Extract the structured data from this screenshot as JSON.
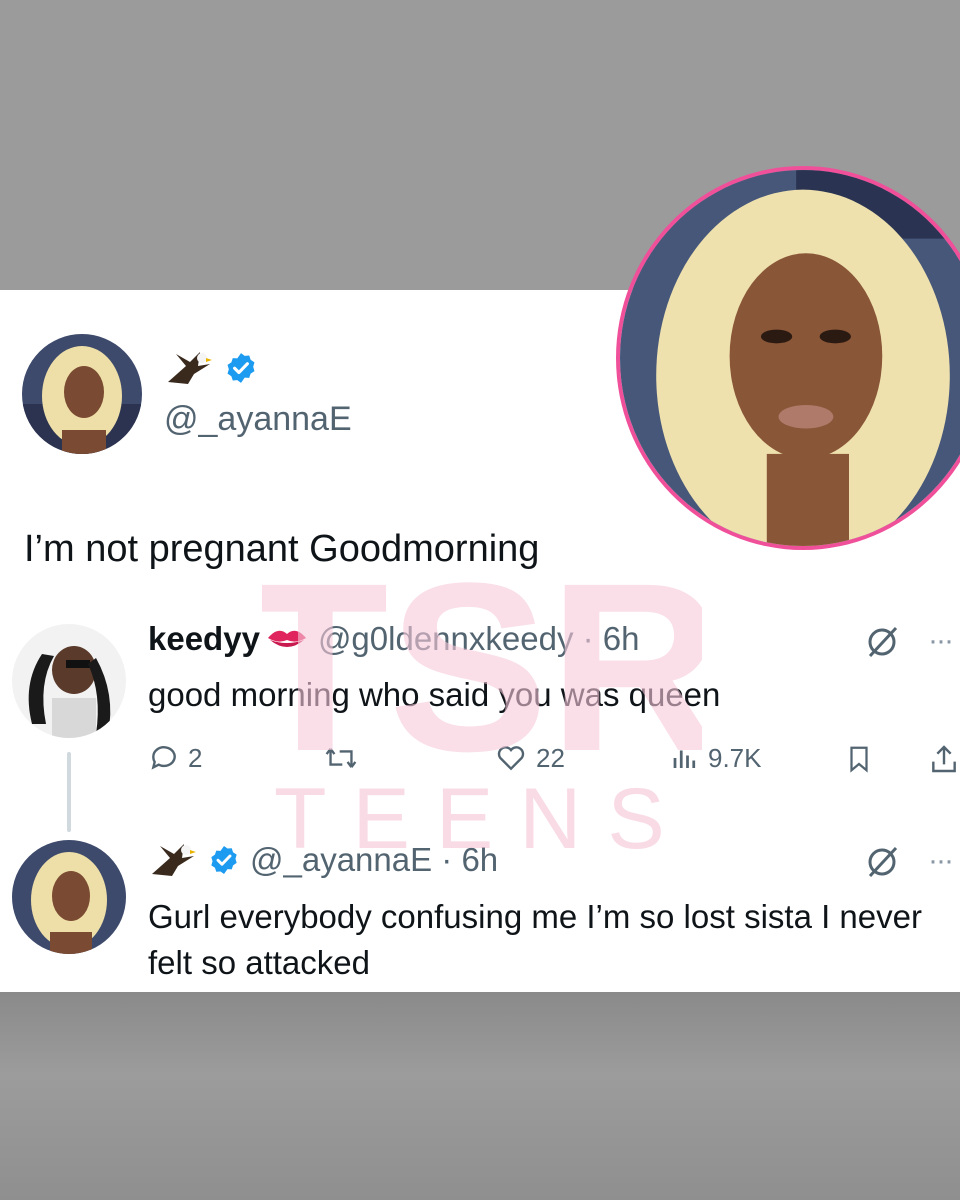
{
  "main_post": {
    "handle": "@_ayannaE",
    "text": "I’m not pregnant Goodmorning"
  },
  "reply1": {
    "name": "keedyy",
    "handle_time": "@g0ldennxkeedy · 6h",
    "text": "good morning who said you was queen",
    "metrics": {
      "replies": "2",
      "likes": "22",
      "views": "9.7K"
    }
  },
  "reply2": {
    "handle_time": "@_ayannaE · 6h",
    "text": "Gurl everybody confusing me I’m so lost sista I never felt so attacked"
  },
  "watermark": {
    "logo": "TSR",
    "sub": "TEENS"
  },
  "colors": {
    "verified": "#1d9bf0",
    "photo_border": "#f0509a",
    "watermark": "#f6c8d8"
  },
  "icons": [
    "eagle-emoji",
    "verified-badge",
    "kiss-mark-emoji",
    "grok-icon",
    "more-icon",
    "reply-icon",
    "retweet-icon",
    "like-icon",
    "views-icon",
    "bookmark-icon",
    "share-icon"
  ]
}
